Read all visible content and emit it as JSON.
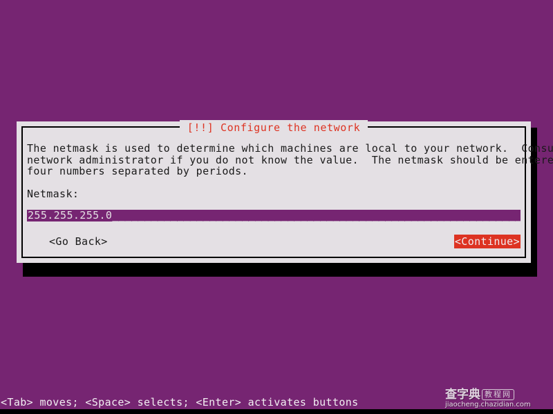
{
  "screen": {
    "background_color": "#762572",
    "foreground_color": "#f2eef2"
  },
  "dialog": {
    "title": "[!!] Configure the network",
    "title_color": "#dd3322",
    "background_color": "#e4e0e4",
    "border_color": "#000000",
    "body_lines": [
      "The netmask is used to determine which machines are local to your network.  Consult your",
      "network administrator if you do not know the value.  The netmask should be entered as",
      "four numbers separated by periods."
    ],
    "field": {
      "label": "Netmask:",
      "value": "255.255.255.0",
      "filler": "_______________________________________________________________________________",
      "background_color": "#762572",
      "text_color": "#e4e0e4"
    },
    "buttons": {
      "go_back": {
        "label": "<Go Back>",
        "selected": false
      },
      "continue": {
        "label": "<Continue>",
        "selected": true,
        "selected_background": "#dd3322",
        "selected_text_color": "#f2eef2"
      }
    }
  },
  "help_bar": {
    "text": "<Tab> moves; <Space> selects; <Enter> activates buttons"
  },
  "watermark": {
    "chinese_title": "查字典",
    "badge": "教程网",
    "url": "jiaocheng.chazidian.com"
  }
}
